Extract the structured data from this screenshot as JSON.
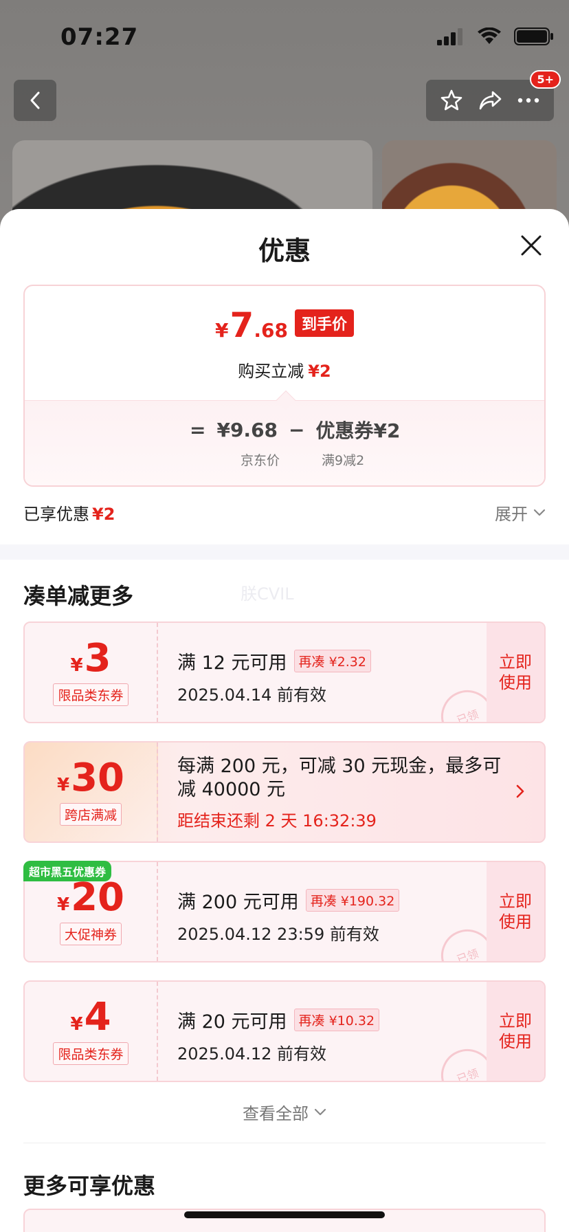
{
  "status_bar": {
    "time": "07:27"
  },
  "nav": {
    "badge": "5+"
  },
  "sheet": {
    "title": "优惠"
  },
  "price_card": {
    "currency": "¥",
    "price_int": "7",
    "price_dec": ".68",
    "tag": "到手价",
    "sub_label": "购买立减",
    "sub_value": "¥2",
    "eq": "=",
    "jd_price": "¥9.68",
    "minus": "−",
    "coupon_item": "优惠券¥2",
    "jd_price_label": "京东价",
    "coupon_label": "满9减2"
  },
  "enjoyed": {
    "label": "已享优惠",
    "value": "¥2"
  },
  "expand": {
    "label": "展开"
  },
  "section1": {
    "title": "凑单减更多",
    "watermark": "朕CVIL"
  },
  "coupons": [
    {
      "currency": "¥",
      "amount": "3",
      "type": "限品类东券",
      "condition": "满 12 元可用",
      "chip": "再凑 ¥2.32",
      "valid": "2025.04.14 前有效",
      "action": "立即使用",
      "stamp": "已领"
    },
    {
      "currency": "¥",
      "amount": "30",
      "type": "跨店满减",
      "text": "每满 200 元，可减 30 元现金，最多可减 40000 元",
      "countdown": "距结束还剩 2 天 16:32:39"
    },
    {
      "badge": "超市黑五优惠券",
      "currency": "¥",
      "amount": "20",
      "type": "大促神券",
      "condition": "满 200 元可用",
      "chip": "再凑 ¥190.32",
      "valid": "2025.04.12 23:59 前有效",
      "action": "立即使用",
      "stamp": "已领"
    },
    {
      "currency": "¥",
      "amount": "4",
      "type": "限品类东券",
      "condition": "满 20 元可用",
      "chip": "再凑 ¥10.32",
      "valid": "2025.04.12 前有效",
      "action": "立即使用",
      "stamp": "已领"
    }
  ],
  "view_all": {
    "label": "查看全部"
  },
  "section2": {
    "title": "更多可享优惠"
  },
  "colors": {
    "accent_red": "#e4231c",
    "badge_green": "#2fbd42"
  }
}
